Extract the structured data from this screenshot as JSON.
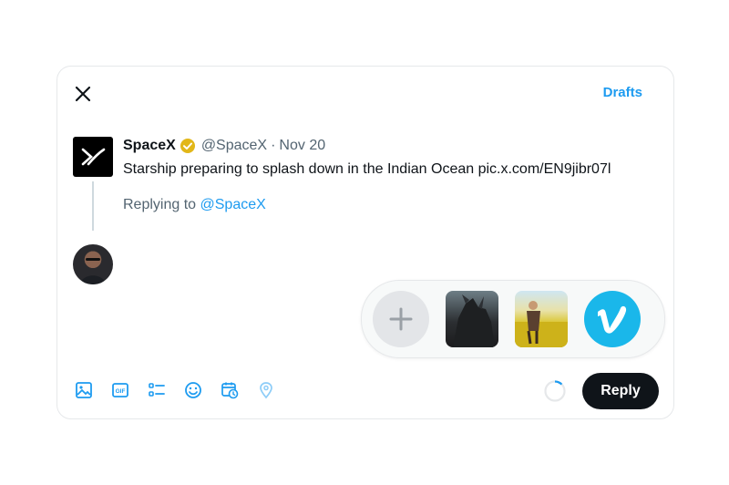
{
  "composer": {
    "drafts_label": "Drafts",
    "reply_button_label": "Reply"
  },
  "tweet": {
    "author_name": "SpaceX",
    "verified": true,
    "handle": "@SpaceX",
    "separator": "·",
    "date": "Nov 20",
    "text": "Starship preparing to splash down in the Indian Ocean pic.x.com/EN9jibr07l"
  },
  "reply_context": {
    "prefix": "Replying to",
    "mention": "@SpaceX"
  },
  "media_picker": {
    "items": [
      "add-media",
      "dragon-thumbnail",
      "field-thumbnail",
      "vimeo-logo"
    ]
  },
  "toolbar": {
    "icons": [
      "image-icon",
      "gif-icon",
      "poll-icon",
      "emoji-icon",
      "schedule-icon",
      "location-icon"
    ]
  },
  "colors": {
    "accent": "#1d9bf0",
    "reply_button_bg": "#0f1419",
    "verified_badge": "#e2b719",
    "vimeo": "#1ab7ea"
  }
}
